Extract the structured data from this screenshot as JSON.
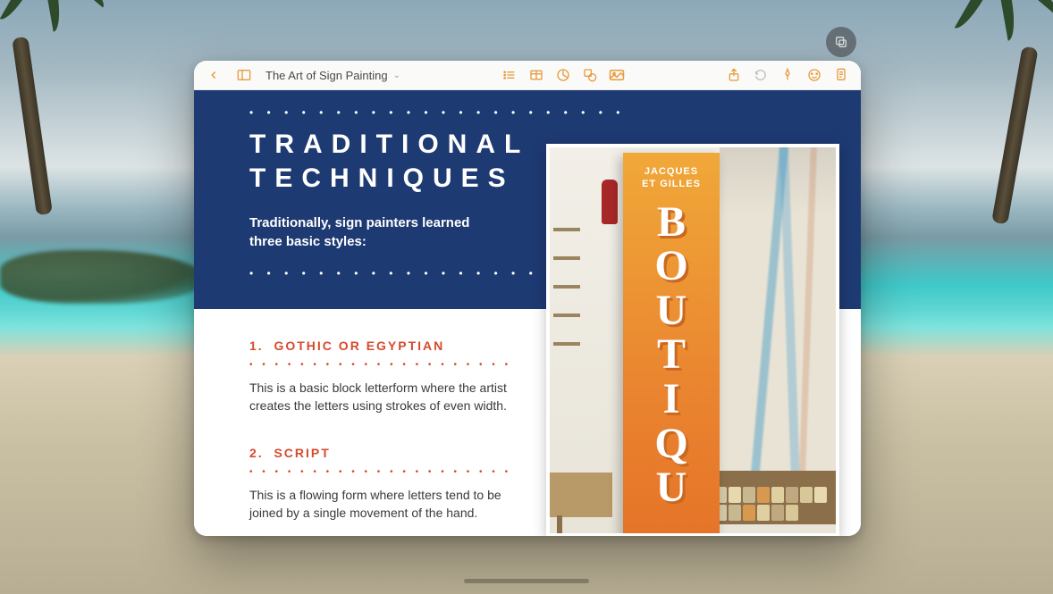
{
  "toolbar": {
    "title": "The Art of Sign Painting"
  },
  "slide": {
    "heading_line1": "TRADITIONAL",
    "heading_line2": "TECHNIQUES",
    "subheading": "Traditionally, sign painters learned three basic styles:",
    "techniques": [
      {
        "number": "1.",
        "title": "GOTHIC OR EGYPTIAN",
        "body": "This is a basic block letterform where the artist creates the letters using strokes of even width."
      },
      {
        "number": "2.",
        "title": "SCRIPT",
        "body": "This is a flowing form where letters tend to be joined by a single movement of the hand."
      }
    ]
  },
  "photo_sign": {
    "top_line1": "JACQUES",
    "top_line2": "ET GILLES",
    "letters": [
      "B",
      "O",
      "U",
      "T",
      "I",
      "Q",
      "U"
    ]
  },
  "colors": {
    "accent": "#e89b3e",
    "blue": "#1e3a73",
    "signOrange": "#ea8530",
    "redText": "#d64a2e"
  }
}
